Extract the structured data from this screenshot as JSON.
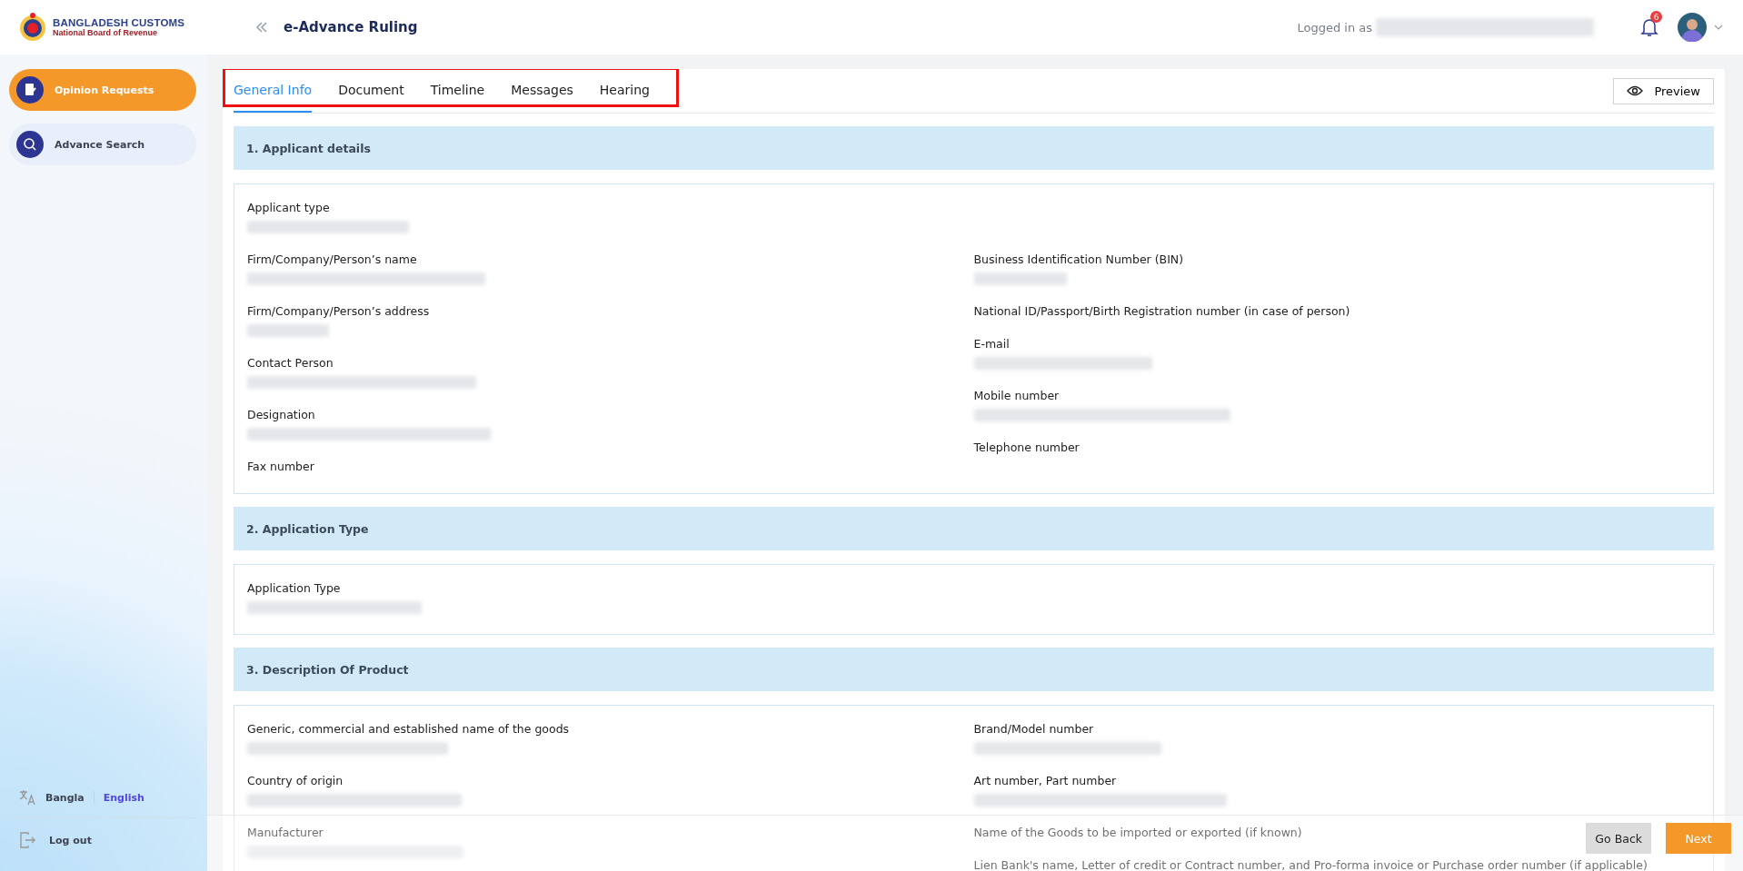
{
  "header": {
    "logo_title": "BANGLADESH CUSTOMS",
    "logo_subtitle": "National Board of Revenue",
    "page_title": "e-Advance Ruling",
    "logged_in_label": "Logged in as",
    "user_redacted": true,
    "notification_count": "6"
  },
  "sidebar": {
    "items": [
      {
        "label": "Opinion Requests",
        "selected": true,
        "kind": "document"
      },
      {
        "label": "Advance Search",
        "selected": false,
        "kind": "search"
      }
    ],
    "languages": [
      {
        "label": "Bangla",
        "selected": false
      },
      {
        "label": "English",
        "selected": true
      }
    ],
    "logout": "Log out"
  },
  "tabs": [
    {
      "label": "General Info",
      "selected": true
    },
    {
      "label": "Document",
      "selected": false
    },
    {
      "label": "Timeline",
      "selected": false
    },
    {
      "label": "Messages",
      "selected": false
    },
    {
      "label": "Hearing",
      "selected": false
    }
  ],
  "preview_button": "Preview",
  "sections": [
    {
      "title": "1. Applicant details",
      "lead_fields": [
        {
          "label": "Applicant type",
          "redacted": true
        }
      ],
      "left_fields": [
        {
          "label": "Firm/Company/Person’s name",
          "redacted": true
        },
        {
          "label": "Firm/Company/Person’s address",
          "redacted": true
        },
        {
          "label": "Contact Person",
          "redacted": true
        },
        {
          "label": "Designation",
          "redacted": true
        },
        {
          "label": "Fax number",
          "redacted": false
        }
      ],
      "right_fields": [
        {
          "label": "Business Identification Number (BIN)",
          "redacted": true
        },
        {
          "label": "National ID/Passport/Birth Registration number (in case of person)",
          "redacted": false
        },
        {
          "label": "E-mail",
          "redacted": true
        },
        {
          "label": "Mobile number",
          "redacted": true
        },
        {
          "label": "Telephone number",
          "redacted": false
        }
      ]
    },
    {
      "title": "2. Application Type",
      "lead_fields": [
        {
          "label": "Application Type",
          "redacted": true
        }
      ]
    },
    {
      "title": "3. Description Of Product",
      "left_fields": [
        {
          "label": "Generic, commercial and established name of the goods",
          "redacted": true
        },
        {
          "label": "Country of origin",
          "redacted": true
        },
        {
          "label": "Manufacturer",
          "redacted": true
        }
      ],
      "right_fields": [
        {
          "label": "Brand/Model number",
          "redacted": true
        },
        {
          "label": "Art number, Part number",
          "redacted": true
        },
        {
          "label": "Name of the Goods to be imported or exported (if known)",
          "redacted": false
        },
        {
          "label": "Lien Bank's name, Letter of credit or Contract number, and Pro-forma invoice or Purchase order number (if applicable)",
          "redacted": false
        }
      ]
    }
  ],
  "footer": {
    "back_button": "Go Back",
    "next_button": "Next"
  }
}
